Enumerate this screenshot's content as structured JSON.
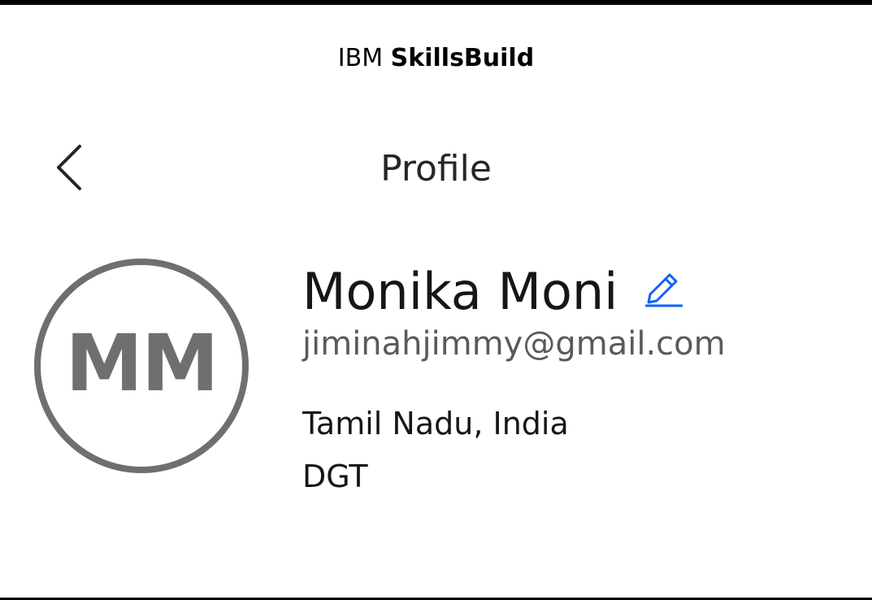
{
  "header": {
    "brand_prefix": "IBM",
    "brand_name": "SkillsBuild"
  },
  "nav": {
    "back_icon": "chevron-left-icon",
    "title": "Profile"
  },
  "profile": {
    "avatar_initials": "MM",
    "name": "Monika Moni",
    "edit_icon": "pencil-edit-icon",
    "email": "jiminahjimmy@gmail.com",
    "location": "Tamil Nadu, India",
    "organization": "DGT"
  },
  "colors": {
    "accent": "#0f62fe",
    "avatar_gray": "#6f6f6f",
    "text_primary": "#161616",
    "text_secondary": "#5a5a5a"
  }
}
